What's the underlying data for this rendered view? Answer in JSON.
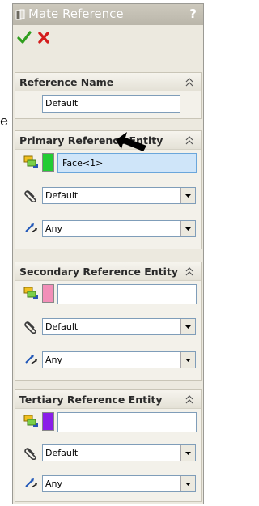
{
  "window": {
    "title": "Mate Reference",
    "help_label": "?"
  },
  "side_fragment": "e",
  "sections": {
    "reference_name": {
      "header": "Reference Name",
      "value": "Default"
    },
    "primary": {
      "header": "Primary Reference Entity",
      "entity": "Face<1>",
      "swatch_color": "#22cc33",
      "constraint": "Default",
      "alignment": "Any"
    },
    "secondary": {
      "header": "Secondary Reference Entity",
      "entity": "",
      "swatch_color": "#f28fb8",
      "constraint": "Default",
      "alignment": "Any"
    },
    "tertiary": {
      "header": "Tertiary Reference Entity",
      "entity": "",
      "swatch_color": "#8a1de8",
      "constraint": "Default",
      "alignment": "Any"
    }
  },
  "icons": {
    "ok": "green-check-icon",
    "cancel": "red-x-icon",
    "entity": "entity-select-icon",
    "constraint": "paperclip-icon",
    "alignment": "alignment-arrows-icon",
    "collapse": "collapse-chevron-icon"
  }
}
